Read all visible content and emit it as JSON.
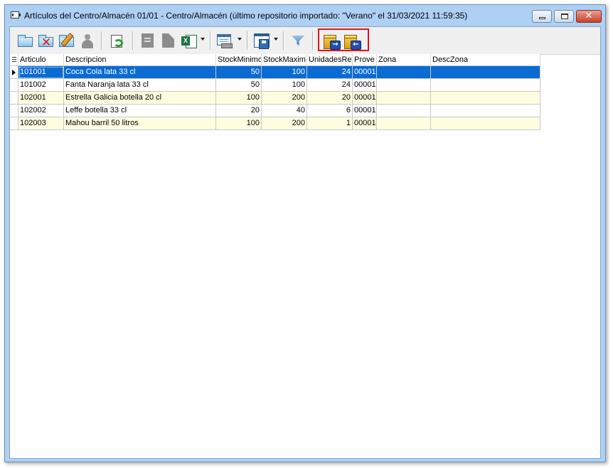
{
  "window": {
    "title": "Artículos del Centro/Almacén 01/01 - Centro/Almacén (último repositorio importado: \"Verano\" el 31/03/2021 11:59:35)",
    "close_glyph": "✕"
  },
  "toolbar": {
    "icons": [
      "new-folder-icon",
      "delete-icon",
      "edit-icon",
      "user-icon",
      "refresh-icon",
      "document-icon",
      "document-corner-icon",
      "excel-icon",
      "report-icon",
      "save-layout-icon",
      "filter-icon",
      "export-box-icon",
      "import-box-icon"
    ],
    "highlight_color": "#e0141e"
  },
  "grid": {
    "columns": [
      "Articulo",
      "Descripcion",
      "StockMinimo",
      "StockMaxim",
      "UnidadesRe",
      "Prove",
      "Zona",
      "DescZona"
    ],
    "rows": [
      {
        "articulo": "101001",
        "descripcion": "Coca Cola lata 33 cl",
        "stock_minimo": "50",
        "stock_maximo": "100",
        "unidades": "24",
        "proveedor": "00001",
        "zona": "",
        "desc_zona": "",
        "selected": true
      },
      {
        "articulo": "101002",
        "descripcion": "Fanta Naranja lata 33 cl",
        "stock_minimo": "50",
        "stock_maximo": "100",
        "unidades": "24",
        "proveedor": "00001",
        "zona": "",
        "desc_zona": ""
      },
      {
        "articulo": "102001",
        "descripcion": "Estrella Galicia botella 20 cl",
        "stock_minimo": "100",
        "stock_maximo": "200",
        "unidades": "20",
        "proveedor": "00001",
        "zona": "",
        "desc_zona": ""
      },
      {
        "articulo": "102002",
        "descripcion": "Leffe botella 33 cl",
        "stock_minimo": "20",
        "stock_maximo": "40",
        "unidades": "6",
        "proveedor": "00001",
        "zona": "",
        "desc_zona": ""
      },
      {
        "articulo": "102003",
        "descripcion": "Mahou barril 50 litros",
        "stock_minimo": "100",
        "stock_maximo": "200",
        "unidades": "1",
        "proveedor": "00001",
        "zona": "",
        "desc_zona": ""
      }
    ],
    "selection_color": "#0a6bd3",
    "alt_row_color": "#fffde0"
  }
}
